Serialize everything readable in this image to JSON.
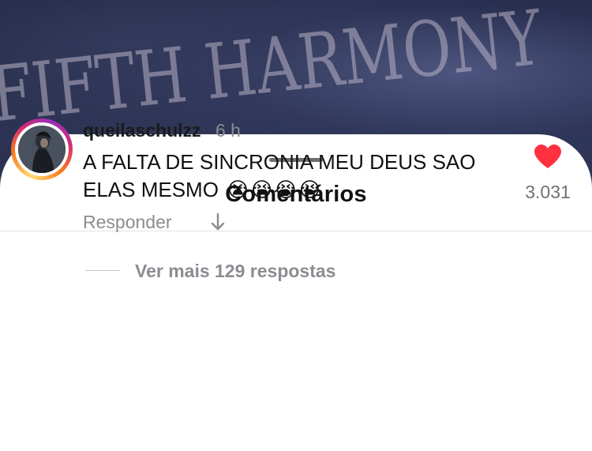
{
  "background": {
    "overlay_text": "FIFTH HARMONY"
  },
  "sheet": {
    "title": "Comentários"
  },
  "comment": {
    "username": "queilaschulzz",
    "time": "6 h",
    "text": "A FALTA DE SINCRONIA MEU DEUS SAO ELAS MESMO",
    "emojis": "😭😭😭😭",
    "like_count": "3.031",
    "liked": true,
    "reply_label": "Responder",
    "view_more_label": "Ver mais 129 respostas"
  },
  "colors": {
    "like": "#ff3040",
    "muted_text": "#8a8d91",
    "primary_text": "#111111"
  },
  "icons": {
    "like": "heart-icon",
    "translate": "arrow-down-icon"
  }
}
